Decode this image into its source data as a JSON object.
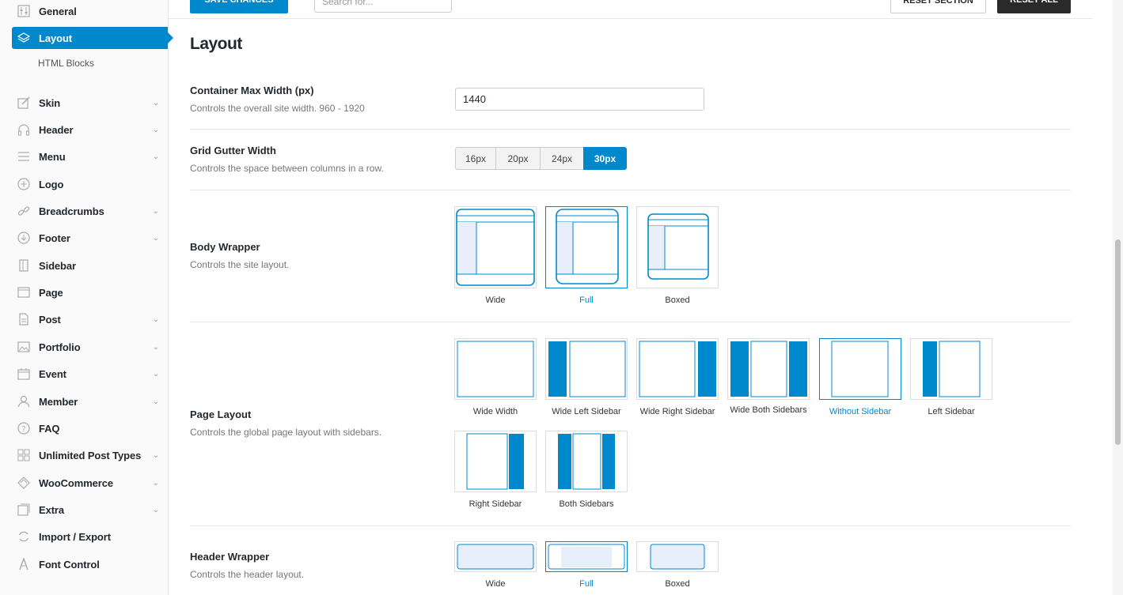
{
  "toolbar": {
    "save_label": "SAVE CHANGES",
    "search_placeholder": "Search for...",
    "reset_section_label": "RESET SECTION",
    "reset_all_label": "RESET ALL"
  },
  "sidebar": {
    "items": [
      {
        "label": "General",
        "icon": "sliders-icon",
        "chevron": false
      },
      {
        "label": "Layout",
        "icon": "layers-icon",
        "chevron": false,
        "active": true
      },
      {
        "label": "Skin",
        "icon": "brush-icon",
        "chevron": true
      },
      {
        "label": "Header",
        "icon": "headphones-icon",
        "chevron": true
      },
      {
        "label": "Menu",
        "icon": "menu-icon",
        "chevron": true
      },
      {
        "label": "Logo",
        "icon": "plus-circle-icon",
        "chevron": false
      },
      {
        "label": "Breadcrumbs",
        "icon": "link-icon",
        "chevron": true
      },
      {
        "label": "Footer",
        "icon": "arrow-down-circle-icon",
        "chevron": true
      },
      {
        "label": "Sidebar",
        "icon": "sidebar-icon",
        "chevron": false
      },
      {
        "label": "Page",
        "icon": "browser-icon",
        "chevron": false
      },
      {
        "label": "Post",
        "icon": "document-icon",
        "chevron": true
      },
      {
        "label": "Portfolio",
        "icon": "image-icon",
        "chevron": true
      },
      {
        "label": "Event",
        "icon": "calendar-icon",
        "chevron": true
      },
      {
        "label": "Member",
        "icon": "user-icon",
        "chevron": true
      },
      {
        "label": "FAQ",
        "icon": "question-icon",
        "chevron": false
      },
      {
        "label": "Unlimited Post Types",
        "icon": "grid-icon",
        "chevron": true
      },
      {
        "label": "WooCommerce",
        "icon": "woo-icon",
        "chevron": true
      },
      {
        "label": "Extra",
        "icon": "puzzle-icon",
        "chevron": true
      },
      {
        "label": "Import / Export",
        "icon": "refresh-icon",
        "chevron": false
      },
      {
        "label": "Font Control",
        "icon": "font-icon",
        "chevron": false
      }
    ],
    "sub_item": "HTML Blocks"
  },
  "main": {
    "title": "Layout",
    "container": {
      "title": "Container Max Width (px)",
      "desc": "Controls the overall site width. 960 - 1920",
      "value": "1440"
    },
    "gutter": {
      "title": "Grid Gutter Width",
      "desc": "Controls the space between columns in a row.",
      "options": [
        "16px",
        "20px",
        "24px",
        "30px"
      ],
      "selected": "30px"
    },
    "body_wrapper": {
      "title": "Body Wrapper",
      "desc": "Controls the site layout.",
      "options": [
        "Wide",
        "Full",
        "Boxed"
      ],
      "selected": "Full"
    },
    "page_layout": {
      "title": "Page Layout",
      "desc": "Controls the global page layout with sidebars.",
      "options": [
        "Wide Width",
        "Wide Left Sidebar",
        "Wide Right Sidebar",
        "Wide Both Sidebars",
        "Without Sidebar",
        "Left Sidebar",
        "Right Sidebar",
        "Both Sidebars"
      ],
      "selected": "Without Sidebar"
    },
    "header_wrapper": {
      "title": "Header Wrapper",
      "desc": "Controls the header layout.",
      "options": [
        "Wide",
        "Full",
        "Boxed"
      ],
      "selected": "Full"
    }
  },
  "colors": {
    "accent": "#0088cc",
    "dark": "#2a2a2a"
  }
}
